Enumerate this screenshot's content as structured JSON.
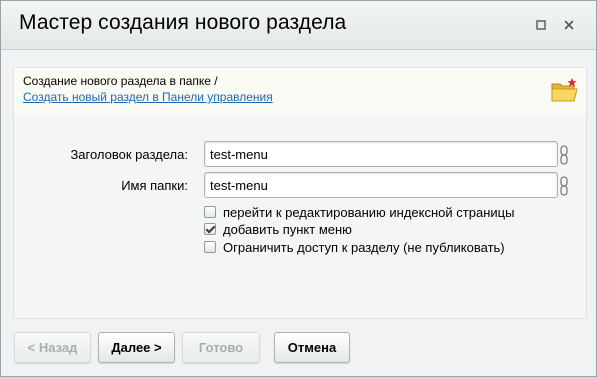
{
  "dialog": {
    "title": "Мастер создания нового раздела",
    "maximize_icon": "maximize-icon",
    "close_icon": "close-icon"
  },
  "info": {
    "text": "Создание нового раздела в папке /",
    "link": "Создать новый раздел в Панели управления",
    "icon": "new-folder-icon"
  },
  "form": {
    "section_title_label": "Заголовок раздела:",
    "section_title_value": "test-menu",
    "folder_name_label": "Имя папки:",
    "folder_name_value": "test-menu",
    "options": [
      {
        "label": "перейти к редактированию индексной страницы",
        "checked": false
      },
      {
        "label": "добавить пункт меню",
        "checked": true
      },
      {
        "label": "Ограничить доступ к разделу (не публиковать)",
        "checked": false
      }
    ]
  },
  "buttons": {
    "back": "< Назад",
    "next": "Далее >",
    "done": "Готово",
    "cancel": "Отмена"
  },
  "colors": {
    "link": "#2067b0",
    "disabled_text": "#a7adb0"
  }
}
